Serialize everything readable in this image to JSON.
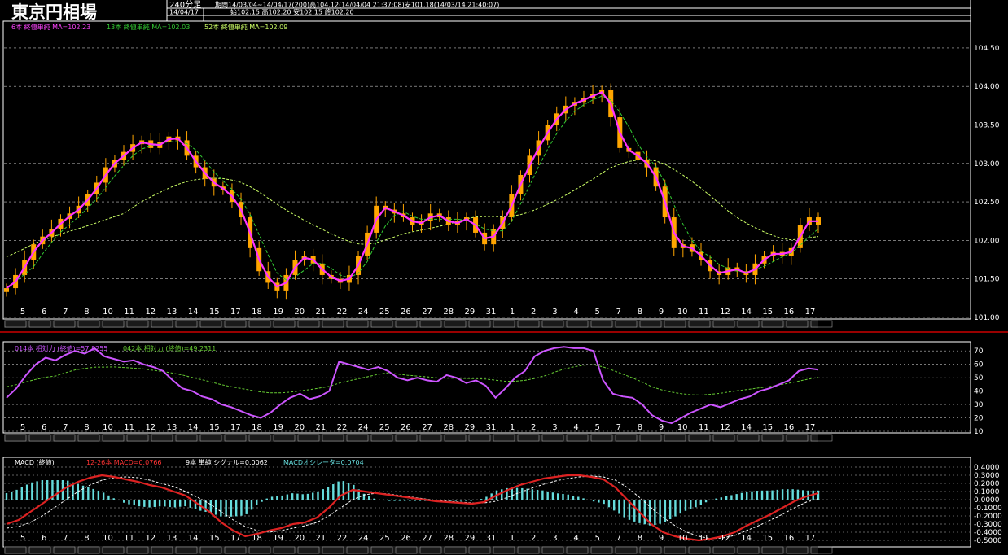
{
  "header": {
    "title": "東京円相場",
    "interval": "240分足",
    "period_info": "期間14/03/04~14/04/17(200)高104.12(14/04/04 21:37:08)安101.18(14/03/14 21:40:07)",
    "date": "14/04/17",
    "ohlc": "始102.15 高102.20 安102.15 終102.20"
  },
  "colors": {
    "background": "#000000",
    "candle": "#ffa500",
    "ma6": "#ff33ff",
    "ma13": "#33cc33",
    "ma52": "#ccff66",
    "rsi14": "#cc55ff",
    "rsi42": "#66cc33",
    "macd": "#dd2222",
    "signal": "#ffffff",
    "hist": "#66dddd",
    "grid": "#ffffff",
    "separator": "#cc0000"
  },
  "day_labels": [
    "5",
    "6",
    "7",
    "8",
    "10",
    "11",
    "12",
    "13",
    "14",
    "15",
    "17",
    "18",
    "19",
    "20",
    "21",
    "22",
    "24",
    "25",
    "26",
    "27",
    "28",
    "29",
    "31",
    "1",
    "2",
    "3",
    "4",
    "5",
    "7",
    "8",
    "9",
    "10",
    "11",
    "12",
    "14",
    "15",
    "16",
    "17"
  ],
  "chart_data": [
    {
      "type": "candlestick",
      "legend": {
        "ma6": "6本 終値単純 MA=102.23",
        "ma13": "13本 終値単純 MA=102.03",
        "ma52": "52本 終値単純 MA=102.09"
      },
      "y_ticks": [
        "104.50",
        "104.00",
        "103.50",
        "103.00",
        "102.50",
        "102.00",
        "101.50",
        "101.00"
      ],
      "ylim": [
        101.0,
        104.7
      ],
      "close": [
        101.38,
        101.55,
        101.75,
        101.95,
        102.05,
        102.15,
        102.28,
        102.35,
        102.45,
        102.6,
        102.75,
        102.95,
        103.05,
        103.15,
        103.25,
        103.3,
        103.2,
        103.28,
        103.35,
        103.3,
        103.1,
        102.95,
        102.8,
        102.7,
        102.65,
        102.5,
        102.3,
        101.9,
        101.6,
        101.45,
        101.35,
        101.55,
        101.75,
        101.8,
        101.7,
        101.55,
        101.5,
        101.45,
        101.55,
        101.8,
        102.1,
        102.45,
        102.4,
        102.35,
        102.3,
        102.2,
        102.25,
        102.35,
        102.3,
        102.2,
        102.25,
        102.3,
        102.1,
        101.95,
        102.15,
        102.3,
        102.6,
        102.85,
        103.1,
        103.3,
        103.5,
        103.65,
        103.75,
        103.8,
        103.85,
        103.9,
        103.95,
        103.6,
        103.2,
        103.15,
        103.05,
        102.95,
        102.7,
        102.3,
        101.9,
        101.95,
        101.85,
        101.75,
        101.6,
        101.55,
        101.65,
        101.6,
        101.55,
        101.7,
        101.8,
        101.85,
        101.8,
        101.9,
        102.2,
        102.3,
        102.2
      ]
    },
    {
      "type": "line",
      "legend": {
        "rsi14": "014本 相対力 (終値)=57.8255",
        "rsi42": "042本 相対力 (終値)=49.2311"
      },
      "y_ticks": [
        "70",
        "60",
        "50",
        "40",
        "30",
        "20",
        "10"
      ],
      "ylim": [
        10,
        75
      ],
      "rsi14": [
        35,
        42,
        52,
        60,
        65,
        63,
        67,
        70,
        68,
        72,
        66,
        64,
        62,
        63,
        60,
        58,
        55,
        48,
        42,
        40,
        36,
        34,
        30,
        28,
        25,
        22,
        20,
        24,
        30,
        35,
        38,
        34,
        36,
        40,
        62,
        60,
        58,
        56,
        58,
        55,
        50,
        48,
        50,
        48,
        47,
        52,
        50,
        46,
        48,
        44,
        35,
        42,
        50,
        55,
        66,
        70,
        72,
        73,
        72,
        72,
        70,
        48,
        38,
        36,
        35,
        30,
        22,
        18,
        16,
        20,
        24,
        27,
        30,
        28,
        31,
        34,
        36,
        40,
        42,
        45,
        48,
        55,
        57,
        56
      ]
    },
    {
      "type": "line",
      "legend": {
        "label": "MACD (終値)",
        "macd": "12-26本 MACD=0.0766",
        "signal": "9本 単純 シグナル=0.0062",
        "oscillator": "MACDオシレータ=0.0704"
      },
      "y_ticks": [
        "0.4000",
        "0.3000",
        "0.2000",
        "0.1000",
        "0.0000",
        "-0.1000",
        "-0.2000",
        "-0.3000",
        "-0.4000",
        "-0.5000"
      ],
      "ylim": [
        -0.55,
        0.42
      ],
      "macd": [
        -0.3,
        -0.25,
        -0.15,
        -0.05,
        0.05,
        0.15,
        0.22,
        0.27,
        0.3,
        0.28,
        0.25,
        0.22,
        0.18,
        0.15,
        0.1,
        0.05,
        -0.05,
        -0.15,
        -0.28,
        -0.38,
        -0.45,
        -0.42,
        -0.38,
        -0.35,
        -0.3,
        -0.28,
        -0.22,
        -0.1,
        0.05,
        0.12,
        0.1,
        0.08,
        0.06,
        0.04,
        0.02,
        0.0,
        -0.02,
        -0.03,
        -0.04,
        -0.05,
        -0.03,
        0.05,
        0.12,
        0.18,
        0.22,
        0.26,
        0.28,
        0.3,
        0.3,
        0.28,
        0.25,
        0.15,
        0.0,
        -0.15,
        -0.3,
        -0.4,
        -0.45,
        -0.48,
        -0.5,
        -0.48,
        -0.45,
        -0.4,
        -0.32,
        -0.25,
        -0.18,
        -0.1,
        -0.02,
        0.04,
        0.08
      ],
      "signal": [
        -0.35,
        -0.33,
        -0.28,
        -0.2,
        -0.1,
        0.0,
        0.1,
        0.18,
        0.24,
        0.27,
        0.28,
        0.27,
        0.24,
        0.2,
        0.16,
        0.1,
        0.03,
        -0.05,
        -0.15,
        -0.25,
        -0.33,
        -0.38,
        -0.4,
        -0.38,
        -0.35,
        -0.32,
        -0.28,
        -0.2,
        -0.1,
        0.0,
        0.06,
        0.08,
        0.07,
        0.05,
        0.03,
        0.01,
        -0.01,
        -0.02,
        -0.03,
        -0.04,
        -0.04,
        -0.02,
        0.03,
        0.09,
        0.14,
        0.19,
        0.23,
        0.26,
        0.28,
        0.29,
        0.28,
        0.24,
        0.15,
        0.03,
        -0.1,
        -0.22,
        -0.32,
        -0.4,
        -0.45,
        -0.48,
        -0.47,
        -0.44,
        -0.38,
        -0.32,
        -0.25,
        -0.18,
        -0.1,
        -0.03,
        0.01
      ]
    }
  ]
}
